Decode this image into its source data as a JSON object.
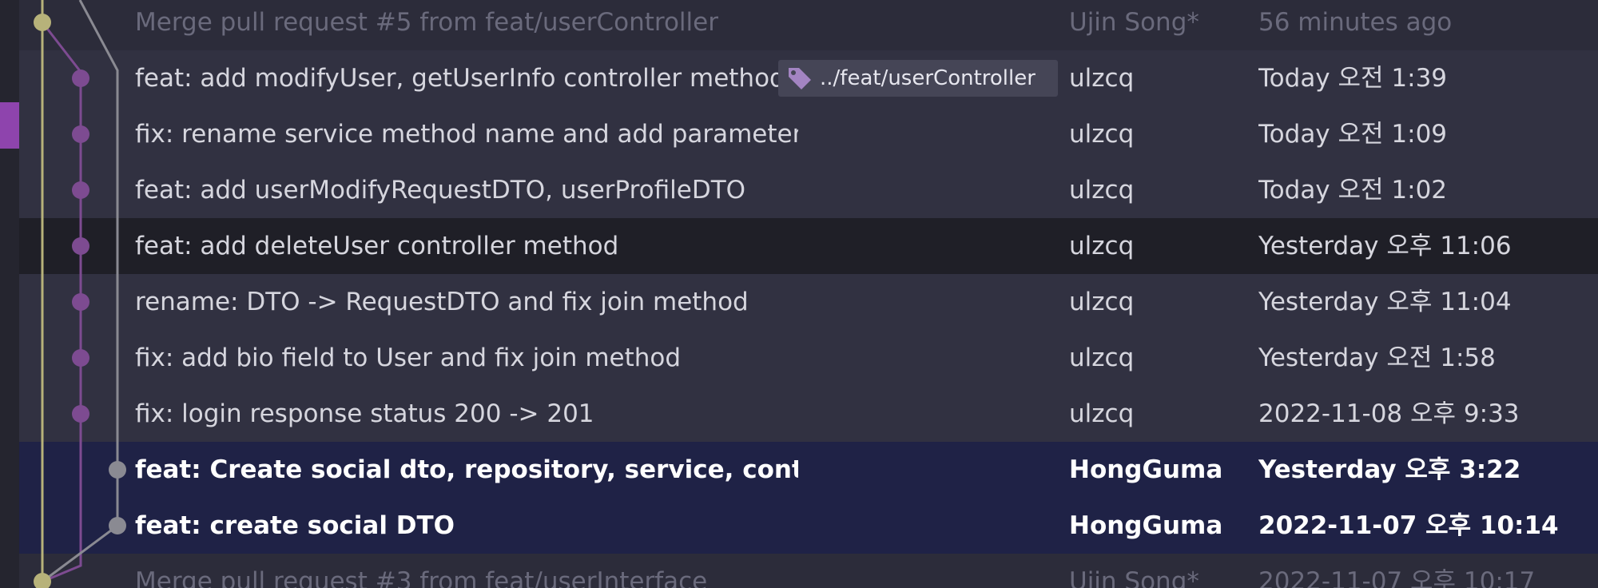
{
  "commits": [
    {
      "message": "Merge pull request #5 from feat/userController",
      "author": "Ujin Song*",
      "date": "56 minutes ago",
      "style": "muted",
      "node_color": "#b7b27a"
    },
    {
      "message": "feat: add modifyUser, getUserInfo controller method",
      "author": "ulzcq",
      "date": "Today 오전 1:39",
      "style": "normal",
      "node_color": "#7d4b91",
      "tag": "../feat/userController"
    },
    {
      "message": "fix: rename service method name and add parameter",
      "author": "ulzcq",
      "date": "Today 오전 1:09",
      "style": "normal",
      "node_color": "#7d4b91"
    },
    {
      "message": "feat: add userModifyRequestDTO, userProfileDTO",
      "author": "ulzcq",
      "date": "Today 오전 1:02",
      "style": "normal",
      "node_color": "#7d4b91"
    },
    {
      "message": "feat: add deleteUser controller method",
      "author": "ulzcq",
      "date": "Yesterday 오후 11:06",
      "style": "normal",
      "node_color": "#7d4b91"
    },
    {
      "message": "rename: DTO -> RequestDTO and fix join method",
      "author": "ulzcq",
      "date": "Yesterday 오후 11:04",
      "style": "normal",
      "node_color": "#7d4b91"
    },
    {
      "message": "fix: add bio field to User and fix join method",
      "author": "ulzcq",
      "date": "Yesterday 오전 1:58",
      "style": "normal",
      "node_color": "#7d4b91"
    },
    {
      "message": "fix: login response status 200 -> 201",
      "author": "ulzcq",
      "date": "2022-11-08 오후 9:33",
      "style": "normal",
      "node_color": "#7d4b91"
    },
    {
      "message": "feat: Create social dto, repository, service, controller file",
      "author": "HongGuma",
      "date": "Yesterday 오후 3:22",
      "style": "bold",
      "node_color": "#8a8a92"
    },
    {
      "message": "feat: create social DTO",
      "author": "HongGuma",
      "date": "2022-11-07 오후 10:14",
      "style": "bold",
      "node_color": "#8a8a92"
    },
    {
      "message": "Merge pull request #3 from feat/userInterface",
      "author": "Ujin Song*",
      "date": "2022-11-07 오후 10:17",
      "style": "muted",
      "node_color": "#b7b27a"
    }
  ],
  "branch_colors": {
    "main": "#b7b27a",
    "feature": "#7d4b91",
    "social": "#8a8a92",
    "side_marker": "#8e44ad"
  },
  "icons": {
    "tag": "tag-icon"
  }
}
